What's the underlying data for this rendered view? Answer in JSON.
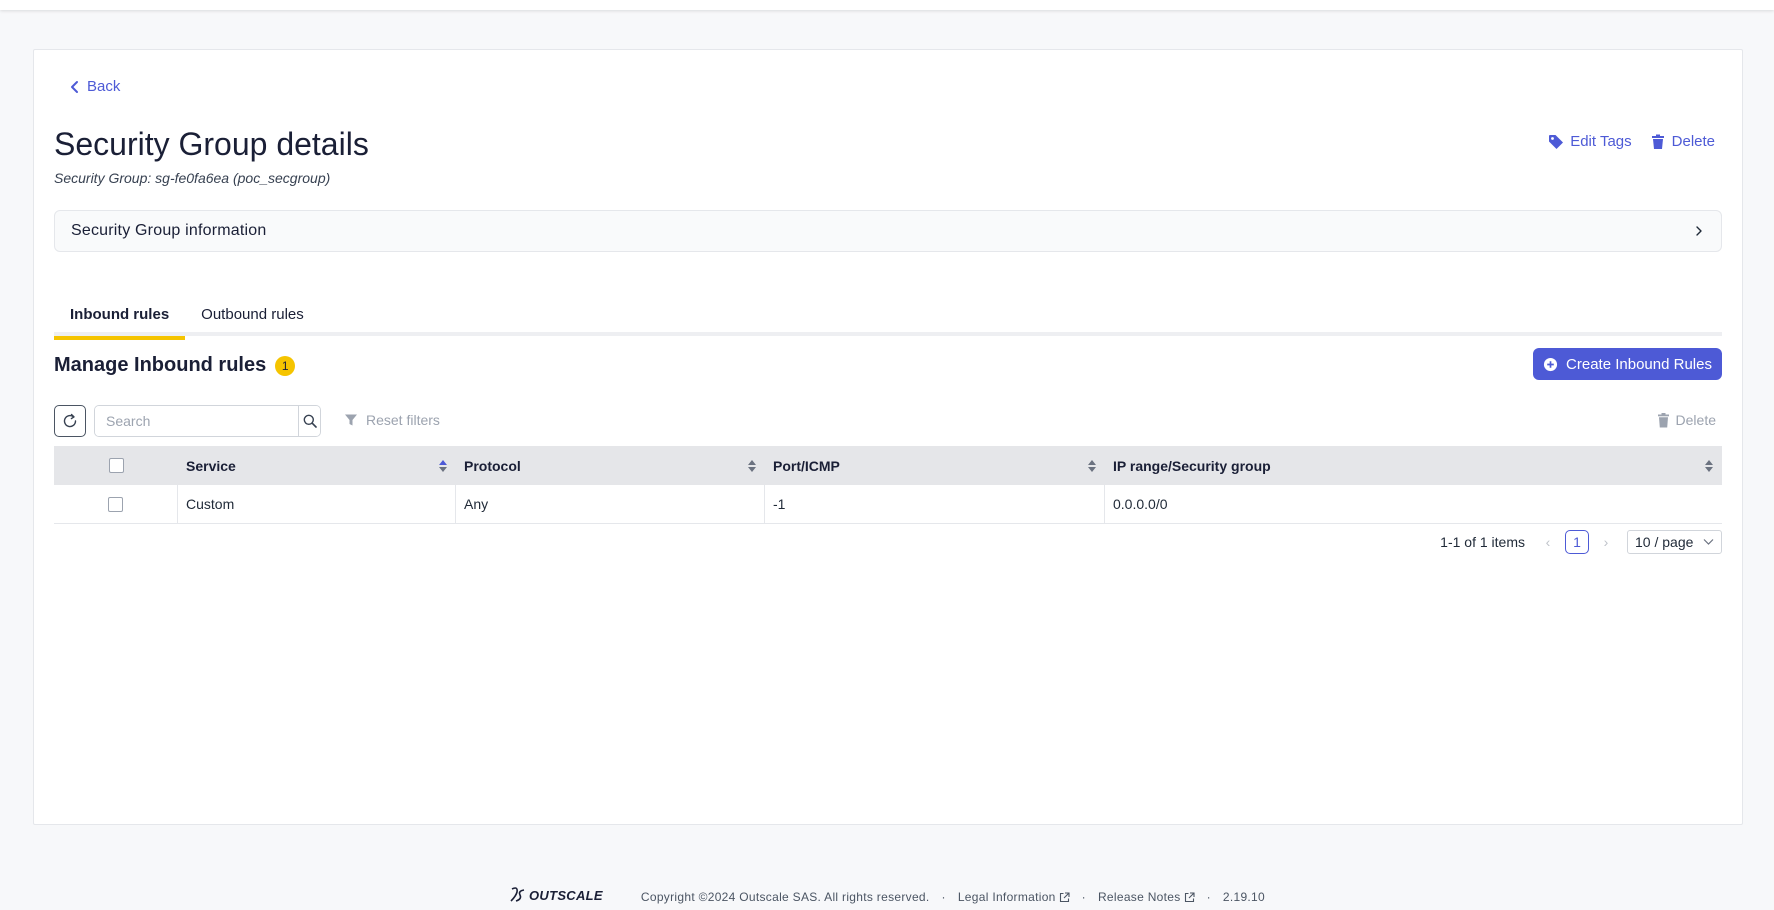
{
  "nav": {
    "back_label": "Back"
  },
  "header": {
    "title": "Security Group details",
    "subtitle": "Security Group: sg-fe0fa6ea (poc_secgroup)",
    "edit_tags_label": "Edit Tags",
    "delete_label": "Delete"
  },
  "info_panel": {
    "label": "Security Group information"
  },
  "tabs": [
    {
      "label": "Inbound rules",
      "active": true
    },
    {
      "label": "Outbound rules",
      "active": false
    }
  ],
  "section": {
    "title": "Manage Inbound rules",
    "count": "1",
    "create_label": "Create Inbound Rules"
  },
  "toolbar": {
    "search_placeholder": "Search",
    "reset_filters_label": "Reset filters",
    "delete_label": "Delete"
  },
  "table": {
    "columns": [
      "Service",
      "Protocol",
      "Port/ICMP",
      "IP range/Security group"
    ],
    "rows": [
      {
        "service": "Custom",
        "protocol": "Any",
        "port": "-1",
        "ip_range": "0.0.0.0/0"
      }
    ]
  },
  "pagination": {
    "summary": "1-1 of 1 items",
    "current_page": "1",
    "page_size": "10 / page"
  },
  "footer": {
    "logo_text": "OUTSCALE",
    "copyright": "Copyright ©2024 Outscale SAS. All rights reserved.",
    "legal_label": "Legal Information",
    "release_notes_label": "Release Notes",
    "version": "2.19.10",
    "separator": "·"
  },
  "colors": {
    "accent": "#4d5ad6",
    "tab_underline": "#f5c400",
    "badge": "#f5c400"
  },
  "icons": [
    "chevron-left-icon",
    "tag-icon",
    "trash-icon",
    "chevron-right-icon",
    "plus-circle-icon",
    "refresh-icon",
    "search-icon",
    "filter-icon",
    "sort-icon",
    "chevron-down-icon",
    "external-link-icon",
    "outscale-logo"
  ]
}
